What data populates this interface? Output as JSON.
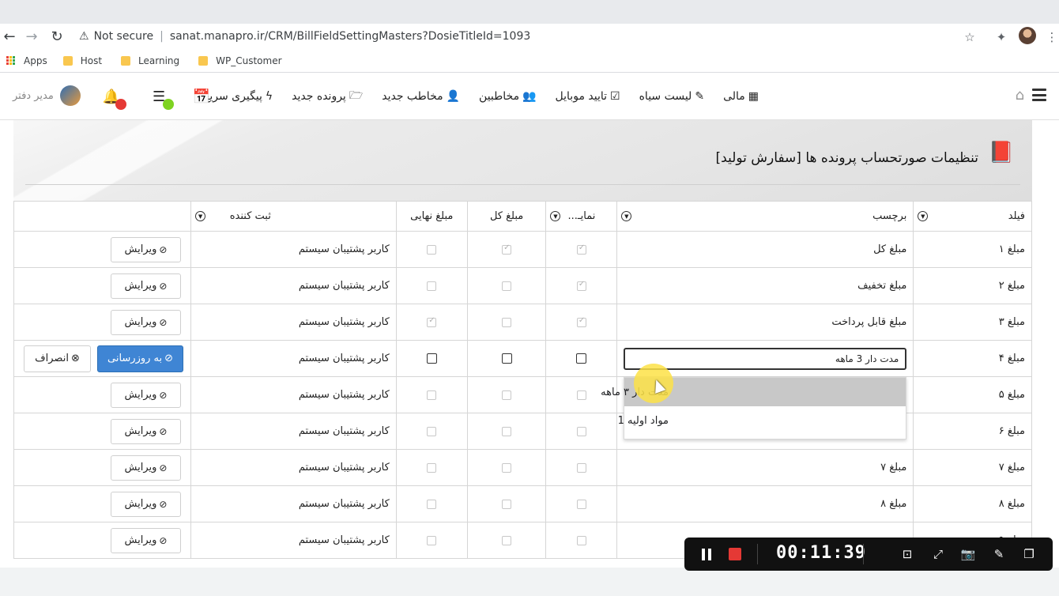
{
  "browser": {
    "security_label": "Not secure",
    "url": "sanat.manapro.ir/CRM/BillFieldSettingMasters?DosieTitleId=1093",
    "bookmarks": [
      {
        "label": "Apps",
        "icon": "apps-grid-icon"
      },
      {
        "label": "Host",
        "icon": "folder-icon"
      },
      {
        "label": "Learning",
        "icon": "folder-icon"
      },
      {
        "label": "WP_Customer",
        "icon": "folder-icon"
      }
    ]
  },
  "app_nav": {
    "items": [
      {
        "label": "مالی",
        "icon": "calculator-icon"
      },
      {
        "label": "لیست سیاه",
        "icon": "edit-icon"
      },
      {
        "label": "تایید موبایل",
        "icon": "check-square-icon"
      },
      {
        "label": "مخاطبین",
        "icon": "users-icon"
      },
      {
        "label": "مخاطب جدید",
        "icon": "user-plus-icon"
      },
      {
        "label": "پرونده جدید",
        "icon": "folder-open-icon"
      },
      {
        "label": "پیگیری سریع",
        "icon": "bolt-icon"
      }
    ],
    "user_name": "مدیر دفتر"
  },
  "page": {
    "title": "تنظیمات صورتحساب پرونده ها [سفارش تولید]"
  },
  "table": {
    "headers": {
      "field": "فیلد",
      "label": "برچسب",
      "show": "نمایـ...",
      "total": "مبلغ کل",
      "final": "مبلغ نهایی",
      "registrar": "ثبت کننده"
    },
    "edit_label": "ویرایش",
    "update_label": "به روزرسانی",
    "cancel_label": "انصراف",
    "rows": [
      {
        "field": "مبلغ ۱",
        "label": "مبلغ کل",
        "show": true,
        "total": true,
        "final": false,
        "registrar": "کاربر پشتیبان سیستم"
      },
      {
        "field": "مبلغ ۲",
        "label": "مبلغ تخفیف",
        "show": true,
        "total": false,
        "final": false,
        "registrar": "کاربر پشتیبان سیستم"
      },
      {
        "field": "مبلغ ۳",
        "label": "مبلغ قابل پرداخت",
        "show": true,
        "total": false,
        "final": true,
        "registrar": "کاربر پشتیبان سیستم"
      },
      {
        "field": "مبلغ ۴",
        "label": "مدت دار 3 ماهه",
        "show": false,
        "total": false,
        "final": false,
        "registrar": "کاربر پشتیبان سیستم",
        "editing": true
      },
      {
        "field": "مبلغ ۵",
        "label": "",
        "show": false,
        "total": false,
        "final": false,
        "registrar": "کاربر پشتیبان سیستم"
      },
      {
        "field": "مبلغ ۶",
        "label": "",
        "show": false,
        "total": false,
        "final": false,
        "registrar": "کاربر پشتیبان سیستم"
      },
      {
        "field": "مبلغ ۷",
        "label": "مبلغ ۷",
        "show": false,
        "total": false,
        "final": false,
        "registrar": "کاربر پشتیبان سیستم"
      },
      {
        "field": "مبلغ ۸",
        "label": "مبلغ ۸",
        "show": false,
        "total": false,
        "final": false,
        "registrar": "کاربر پشتیبان سیستم"
      },
      {
        "field": "مبلغ ۹",
        "label": "",
        "show": false,
        "total": false,
        "final": false,
        "registrar": "کاربر پشتیبان سیستم"
      }
    ]
  },
  "autocomplete": {
    "items": [
      "مدت دار ۳ ماهه",
      "مواد اولیه 1"
    ]
  },
  "recorder": {
    "time": "00:11:39"
  }
}
